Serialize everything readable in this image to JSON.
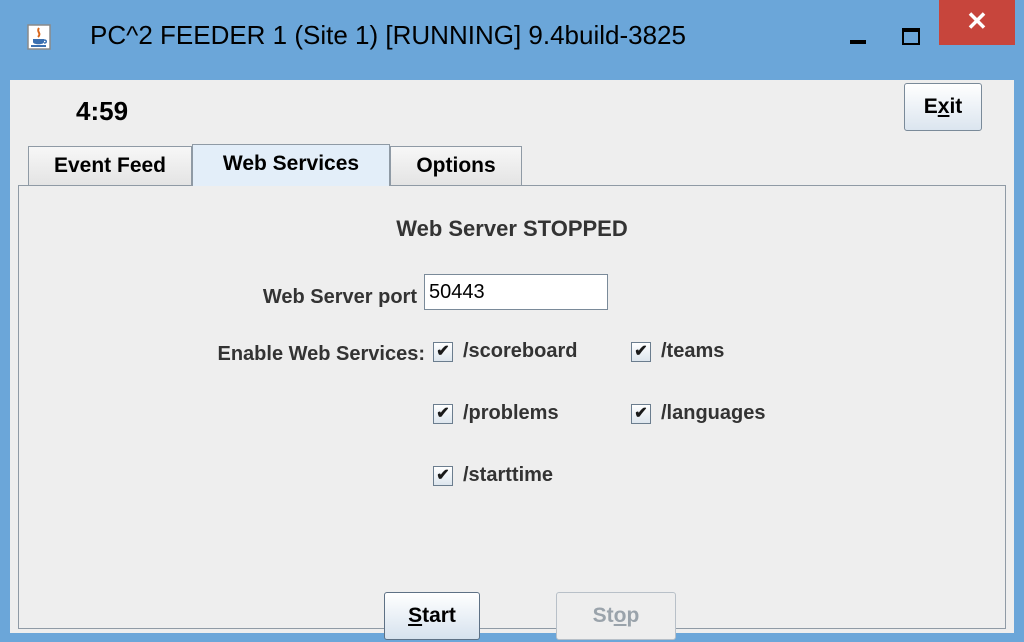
{
  "window": {
    "title": "PC^2 FEEDER 1 (Site 1) [RUNNING] 9.4build-3825",
    "close_glyph": "✕"
  },
  "header": {
    "clock": "4:59",
    "exit_label_prefix": "E",
    "exit_label_mnemonic": "x",
    "exit_label_suffix": "it"
  },
  "tabs": [
    {
      "label": "Event Feed",
      "selected": false
    },
    {
      "label": "Web Services",
      "selected": true
    },
    {
      "label": "Options",
      "selected": false
    }
  ],
  "web_services": {
    "status": "Web Server STOPPED",
    "port_label": "Web Server port",
    "port_value": "50443",
    "enable_label": "Enable Web Services:",
    "services": [
      {
        "label": "/scoreboard",
        "checked": true
      },
      {
        "label": "/teams",
        "checked": true
      },
      {
        "label": "/problems",
        "checked": true
      },
      {
        "label": "/languages",
        "checked": true
      },
      {
        "label": "/starttime",
        "checked": true
      }
    ],
    "check_glyph": "✔",
    "start_mnemonic": "S",
    "start_rest": "tart",
    "stop_prefix": "St",
    "stop_mnemonic": "o",
    "stop_suffix": "p"
  }
}
